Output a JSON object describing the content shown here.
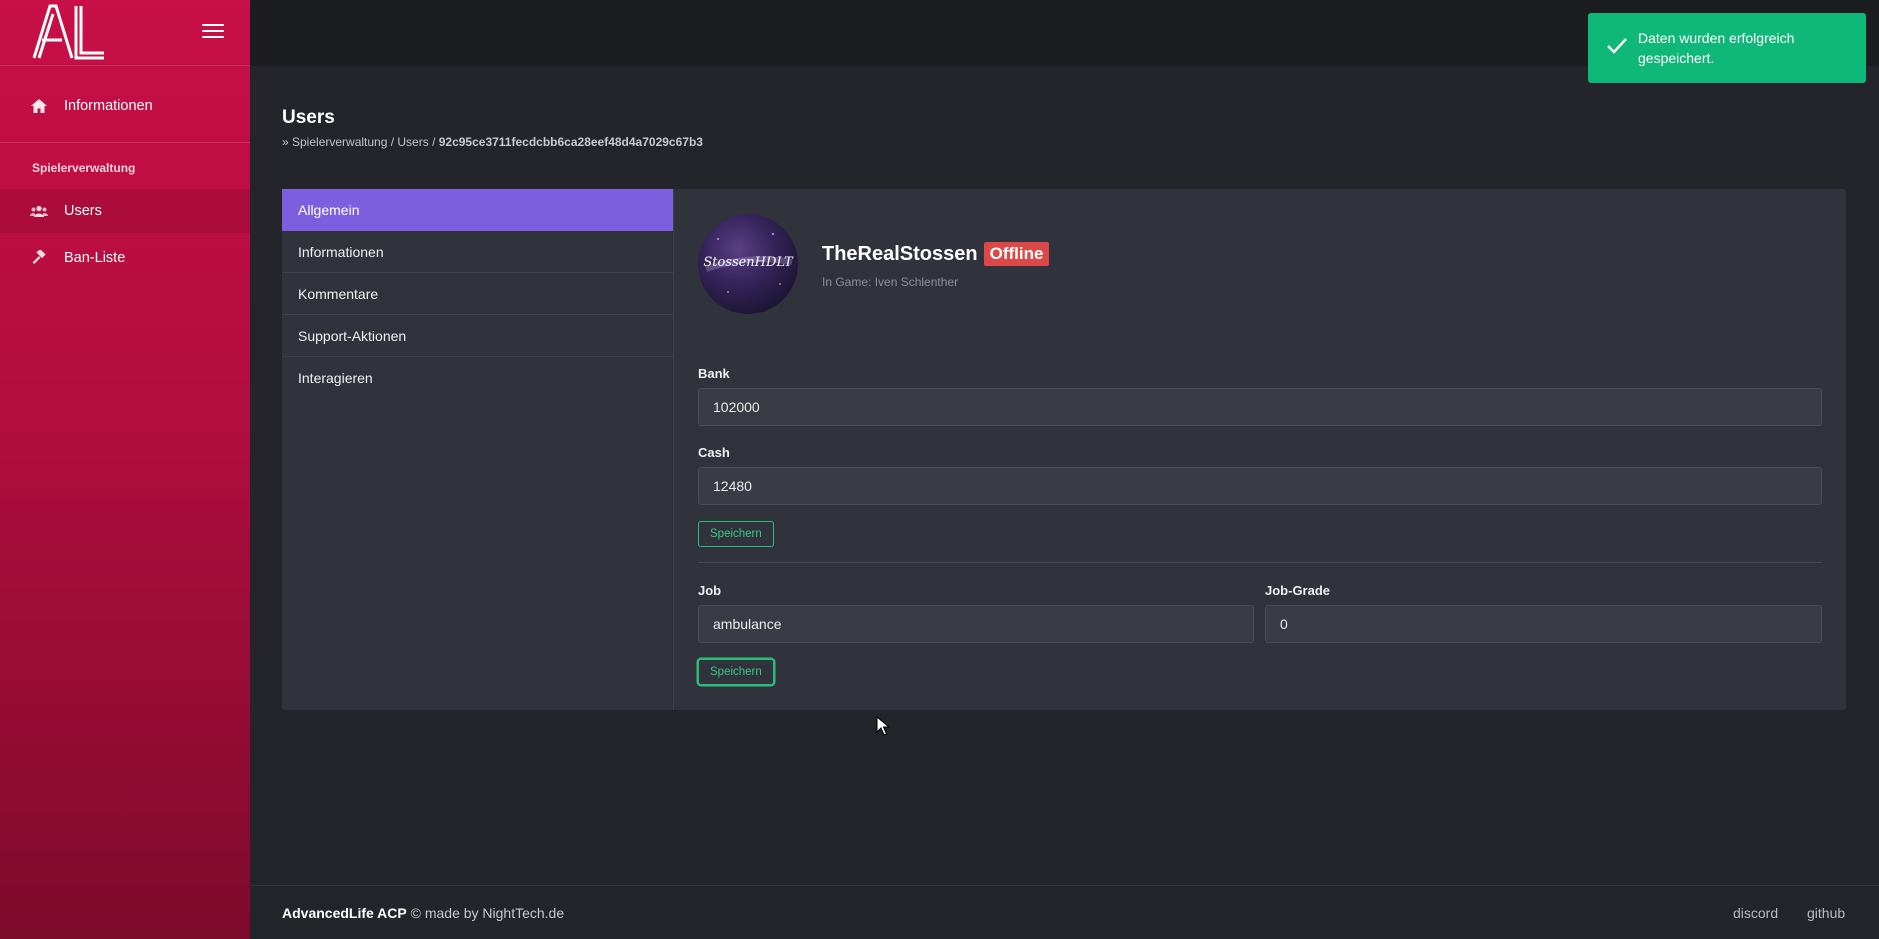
{
  "app": {
    "logo_text": "AL"
  },
  "sidebar": {
    "items": [
      {
        "label": "Informationen",
        "icon": "home-icon"
      },
      {
        "label": "Users",
        "icon": "users-icon"
      },
      {
        "label": "Ban-Liste",
        "icon": "hammer-icon"
      }
    ],
    "section_label": "Spielerverwaltung"
  },
  "page": {
    "title": "Users",
    "breadcrumb_prefix": "» Spielerverwaltung / Users / ",
    "breadcrumb_id": "92c95ce3711fecdcbb6ca28eef48d4a7029c67b3"
  },
  "tabs": [
    "Allgemein",
    "Informationen",
    "Kommentare",
    "Support-Aktionen",
    "Interagieren"
  ],
  "profile": {
    "username": "TheRealStossen",
    "status": "Offline",
    "ingame": "In Game: Iven Schlenther",
    "avatar_text": "StossenHDLT"
  },
  "form": {
    "bank_label": "Bank",
    "bank_value": "102000",
    "cash_label": "Cash",
    "cash_value": "12480",
    "save1_label": "Speichern",
    "job_label": "Job",
    "job_value": "ambulance",
    "job_grade_label": "Job-Grade",
    "job_grade_value": "0",
    "save2_label": "Speichern"
  },
  "footer": {
    "brand": "AdvancedLife ACP",
    "credit": " © made by NightTech.de",
    "links": [
      "discord",
      "github"
    ]
  },
  "toast": {
    "message": "Daten wurden erfolgreich gespeichert."
  },
  "colors": {
    "sidebar": "#c80f47",
    "accent": "#7b5fdf",
    "success": "#0fb878",
    "danger": "#dc4848"
  }
}
